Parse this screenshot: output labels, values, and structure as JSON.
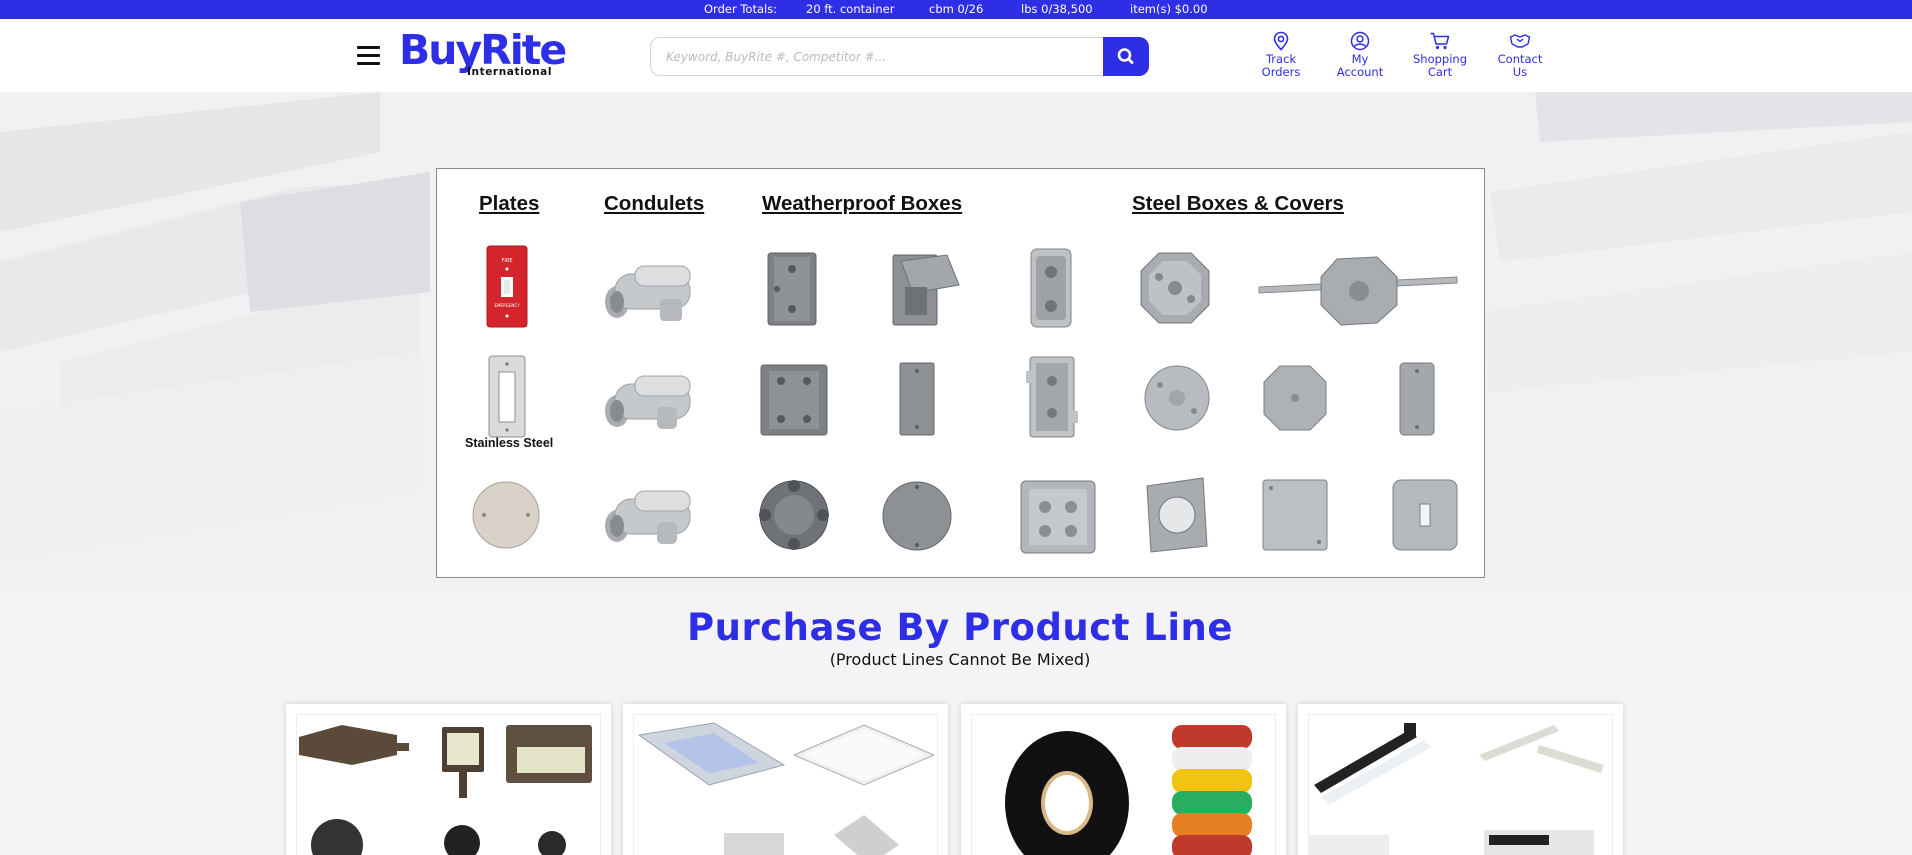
{
  "order_bar": {
    "label": "Order Totals:",
    "container": "20 ft. container",
    "cbm": "cbm 0/26",
    "lbs": "lbs 0/38,500",
    "items": "item(s) $0.00"
  },
  "header": {
    "logo_text": "BuyRite",
    "logo_sub": "International",
    "search_placeholder": "Keyword, BuyRite #, Competitor #...",
    "nav": [
      {
        "line1": "Track",
        "line2": "Orders",
        "icon": "location-pin-icon"
      },
      {
        "line1": "My",
        "line2": "Account",
        "icon": "user-icon"
      },
      {
        "line1": "Shopping",
        "line2": "Cart",
        "icon": "cart-icon"
      },
      {
        "line1": "Contact",
        "line2": "Us",
        "icon": "handshake-icon"
      }
    ]
  },
  "catalog": {
    "headings": {
      "plates": "Plates",
      "condulets": "Condulets",
      "weatherproof": "Weatherproof Boxes",
      "steel": "Steel Boxes & Covers"
    },
    "stainless_caption": "Stainless Steel"
  },
  "product_line": {
    "title": "Purchase By Product Line",
    "subtitle": "(Product Lines Cannot Be Mixed)"
  },
  "colors": {
    "brand_blue": "#2d2ee6",
    "plate_red": "#d4252c",
    "metal_gray": "#8d9196"
  }
}
